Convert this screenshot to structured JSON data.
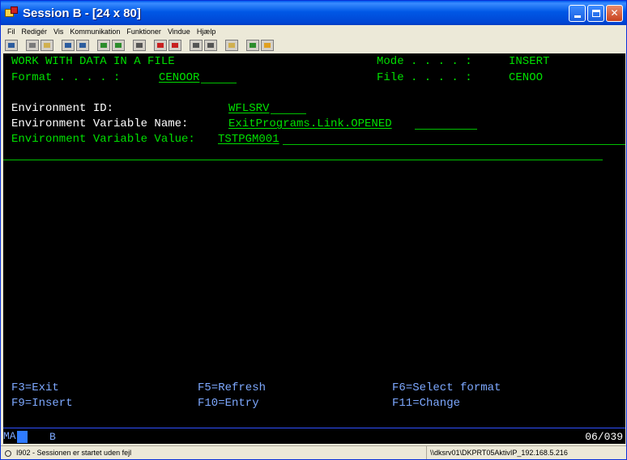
{
  "window": {
    "title": "Session B - [24 x 80]"
  },
  "menu": [
    "Fil",
    "Redigér",
    "Vis",
    "Kommunikation",
    "Funktioner",
    "Vindue",
    "Hjælp"
  ],
  "toolbar_icons": [
    {
      "name": "print-screen-icon",
      "color": "#2c5c9e"
    },
    {
      "name": "copy-icon",
      "color": "#7a7a7a"
    },
    {
      "name": "paste-icon",
      "color": "#d0b050"
    },
    {
      "name": "send-icon",
      "color": "#2c5c9e"
    },
    {
      "name": "receive-icon",
      "color": "#2c5c9e"
    },
    {
      "name": "display-icon",
      "color": "#2c8c2c"
    },
    {
      "name": "keyboard-icon",
      "color": "#2c8c2c"
    },
    {
      "name": "macro-icon",
      "color": "#555555"
    },
    {
      "name": "record-icon",
      "color": "#c82020"
    },
    {
      "name": "stop-icon",
      "color": "#c82020"
    },
    {
      "name": "play-icon",
      "color": "#555555"
    },
    {
      "name": "edit-macro-icon",
      "color": "#555555"
    },
    {
      "name": "help-icon",
      "color": "#d0b050"
    },
    {
      "name": "globe-icon",
      "color": "#2c8c2c"
    },
    {
      "name": "pencil-icon",
      "color": "#e0a020"
    }
  ],
  "screen": {
    "title": "WORK WITH DATA IN A FILE",
    "mode_label": "Mode . . . . :",
    "mode_value": "INSERT",
    "format_label": "Format . . . . :",
    "format_value": "CENOOR",
    "file_label": "File . . . . :",
    "file_value": "CENOO",
    "env_id_label": "Environment ID:",
    "env_id_value": "WFLSRV",
    "env_var_name_label": "Environment Variable Name:",
    "env_var_name_value": "ExitPrograms.Link.OPENED",
    "env_var_value_label": "Environment Variable Value:",
    "env_var_value_value": "TSTPGM001",
    "fkeys": {
      "f3": "F3=Exit",
      "f5": "F5=Refresh",
      "f6": "F6=Select format",
      "f9": "F9=Insert",
      "f10": "F10=Entry",
      "f11": "F11=Change"
    }
  },
  "oia": {
    "mode": "MA",
    "session": "B",
    "cursor_pos": "06/039"
  },
  "status": {
    "message": "I902 - Sessionen er startet uden fejl",
    "connection": "\\\\dksrv01\\DKPRT05AktivIP_192.168.5.216"
  }
}
